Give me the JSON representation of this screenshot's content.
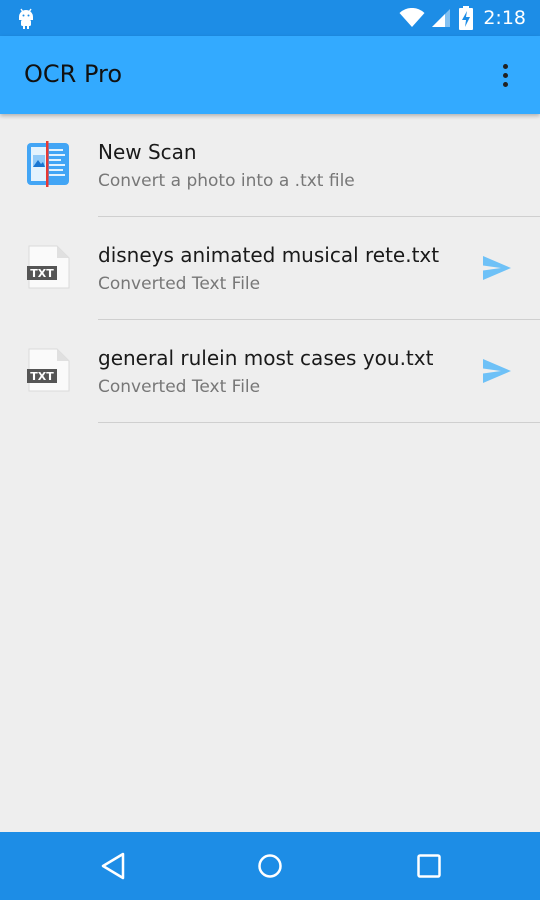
{
  "status_bar": {
    "time": "2:18",
    "icons": [
      "android-icon",
      "wifi-icon",
      "signal-icon",
      "battery-charging-icon"
    ]
  },
  "app_bar": {
    "title": "OCR Pro",
    "overflow_icon": "more-vert-icon"
  },
  "list": {
    "new_scan": {
      "title": "New Scan",
      "subtitle": "Convert a photo into a .txt file",
      "icon": "scan-document-icon"
    },
    "files": [
      {
        "title": "disneys animated musical rete.txt",
        "subtitle": "Converted Text File",
        "icon": "txt-file-icon",
        "file_icon_label": "TXT",
        "action_icon": "send-icon"
      },
      {
        "title": "general rulein most cases you.txt",
        "subtitle": "Converted Text File",
        "icon": "txt-file-icon",
        "file_icon_label": "TXT",
        "action_icon": "send-icon"
      }
    ]
  },
  "nav_bar": {
    "buttons": [
      "back-icon",
      "home-icon",
      "recents-icon"
    ]
  },
  "colors": {
    "status_bar": "#1D8DE6",
    "app_bar": "#33AAFF",
    "background": "#EEEEEE",
    "send_icon": "#6EC1F7",
    "nav_bar": "#1D8DE6"
  }
}
